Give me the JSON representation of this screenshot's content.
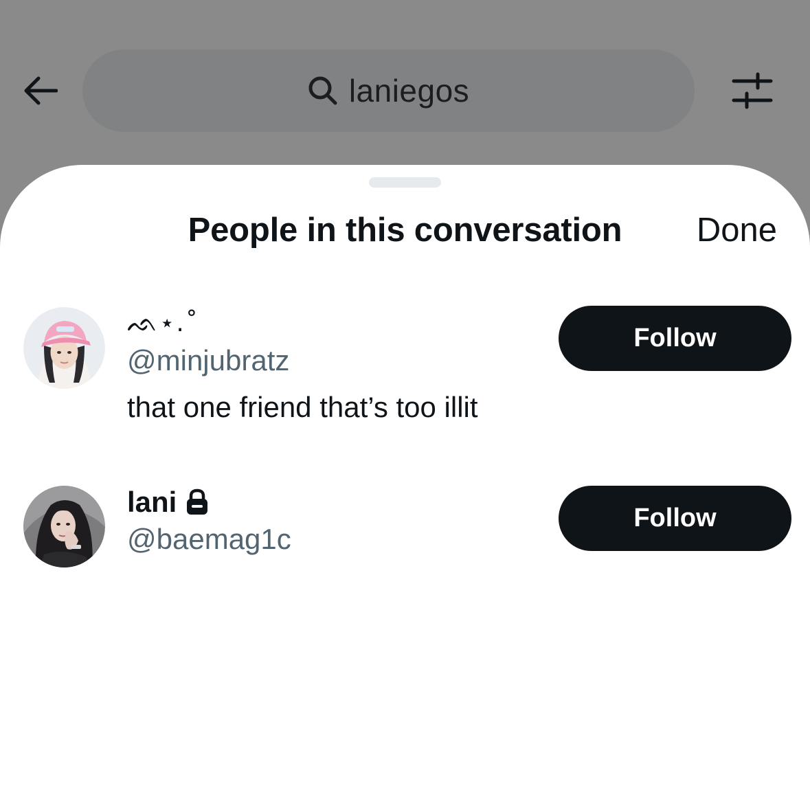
{
  "search": {
    "query": "laniegos"
  },
  "sheet": {
    "title": "People in this conversation",
    "done_label": "Done"
  },
  "users": [
    {
      "display_name": "ᨒ⋆.˚",
      "handle": "@minjubratz",
      "bio": "that one friend that’s too illit",
      "follow_label": "Follow",
      "protected": false
    },
    {
      "display_name": "lani",
      "handle": "@baemag1c",
      "bio": "",
      "follow_label": "Follow",
      "protected": true
    }
  ],
  "colors": {
    "background_dim": "#8a8a8a",
    "search_pill": "#808284",
    "sheet_bg": "#ffffff",
    "primary_text": "#0f1419",
    "secondary_text": "#536471",
    "button_bg": "#0f1419",
    "button_text": "#ffffff"
  },
  "icons": {
    "back": "arrow-left-icon",
    "search": "search-icon",
    "filter": "sliders-icon",
    "protected": "lock-icon"
  }
}
